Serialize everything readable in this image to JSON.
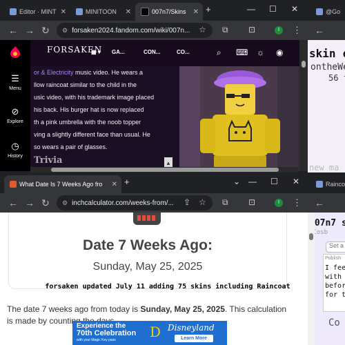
{
  "top_window": {
    "tabs": [
      {
        "label": "Editor · MINT"
      },
      {
        "label": "MINITOON"
      },
      {
        "label": "007n7/Skins"
      }
    ],
    "url": "forsaken2024.fandom.com/wiki/007n...",
    "sidebar": {
      "menu": "Menu",
      "explore": "Explore",
      "history": "History"
    },
    "header": {
      "logo": "FORSAKEN",
      "menu1": "GA...",
      "menu2": "CON...",
      "menu3": "CO..."
    },
    "article_lines": [
      {
        "link": "or & Electricity",
        "text": " music video. He wears a"
      },
      {
        "text": "llow raincoat similar to the child in the"
      },
      {
        "text": "usic video, with his trademark image placed"
      },
      {
        "text": "his back. His burger hat is now replaced"
      },
      {
        "text": "th a pink umbrella with the noob topper"
      },
      {
        "text": "ving a slightly different face than usual. He"
      },
      {
        "text": "so wears a pair of glasses."
      }
    ],
    "next_heading": "Trivia"
  },
  "right_top": {
    "tab": "@Go",
    "lines": [
      "skin co",
      "ontheWe",
      "56 f"
    ],
    "bottom": "new ma"
  },
  "bottom_window": {
    "tab": "What Date Is 7 Weeks Ago fro",
    "url": "inchcalculator.com/weeks-from/...",
    "heading": "Date 7 Weeks Ago:",
    "date": "Sunday, May 25, 2025",
    "note": "forsaken updated July 11 adding 75 skins including Raincoat",
    "text_pre": "The date 7 weeks ago from today is ",
    "text_bold": "Sunday, May 25, 2025",
    "text_post": ". This calculation is made by counting the days.",
    "ad": {
      "line1": "Experience the",
      "line2": "70th Celebration",
      "line3": "with your Magic Key pass",
      "brand": "Disneyland",
      "cta": "Learn More"
    }
  },
  "right_bottom": {
    "tab": "Rainco",
    "title": "007n7 s",
    "sub": "@Cosb",
    "button": "Set a",
    "publish": "Publish",
    "lines": [
      "I feel",
      "with t",
      "befor",
      "for th"
    ],
    "bottom": "Co"
  },
  "colors": {
    "fandom_purple": "#1a0f24",
    "link": "#b780ff",
    "ad_blue": "#1f6fd1"
  }
}
